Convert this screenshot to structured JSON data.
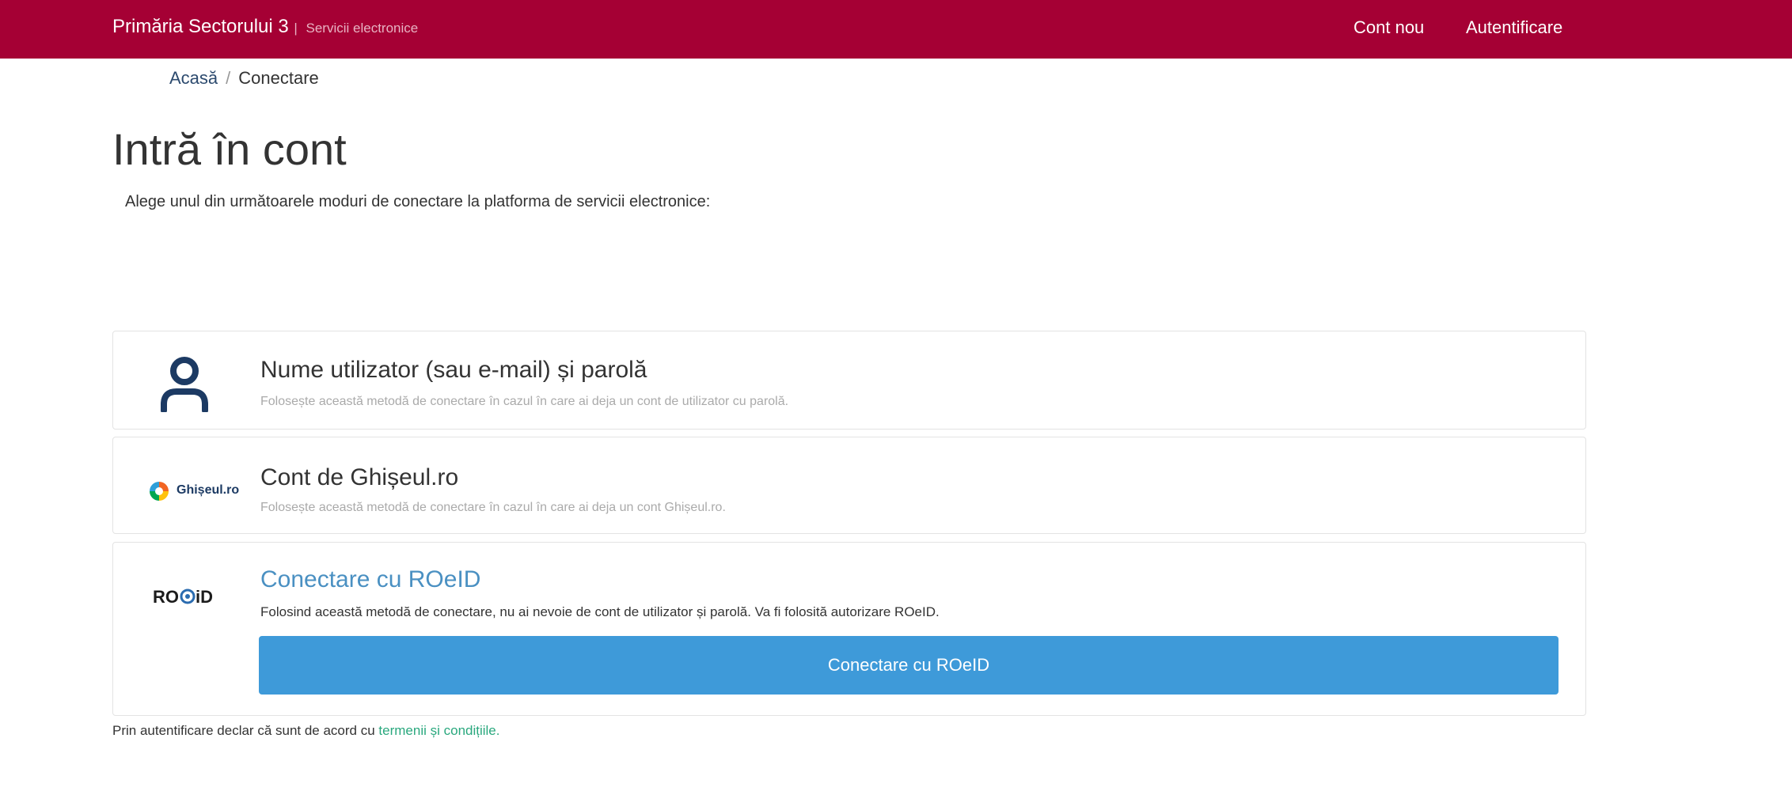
{
  "header": {
    "brand": "Primăria Sectorului 3",
    "brand_separator": "|",
    "brand_sub": "Servicii electronice",
    "nav_cont_nou": "Cont nou",
    "nav_autentificare": "Autentificare",
    "color": "#a50034"
  },
  "breadcrumb": {
    "home": "Acasă",
    "separator": "/",
    "current": "Conectare"
  },
  "page": {
    "title": "Intră în cont",
    "intro": "Alege unul din următoarele moduri de conectare la platforma de servicii electronice:"
  },
  "options": {
    "user": {
      "title": "Nume utilizator (sau e-mail) și parolă",
      "desc": "Folosește această metodă de conectare în cazul în care ai deja un cont de utilizator cu parolă.",
      "icon": "user-icon"
    },
    "ghiseul": {
      "title": "Cont de Ghișeul.ro",
      "desc": "Folosește această metodă de conectare în cazul în care ai deja un cont Ghișeul.ro.",
      "logo_text": "Ghișeul.ro"
    },
    "roeid": {
      "title": "Conectare cu ROeID",
      "desc": "Folosind această metodă de conectare, nu ai nevoie de cont de utilizator și parolă. Va fi folosită autorizare ROeID.",
      "button_label": "Conectare cu ROeID",
      "logo_text": "ROeID",
      "button_color": "#3e9ad9"
    }
  },
  "footer": {
    "terms_prefix": "Prin autentificare declar că sunt de acord cu",
    "terms_link": "termenii și condițiile."
  }
}
